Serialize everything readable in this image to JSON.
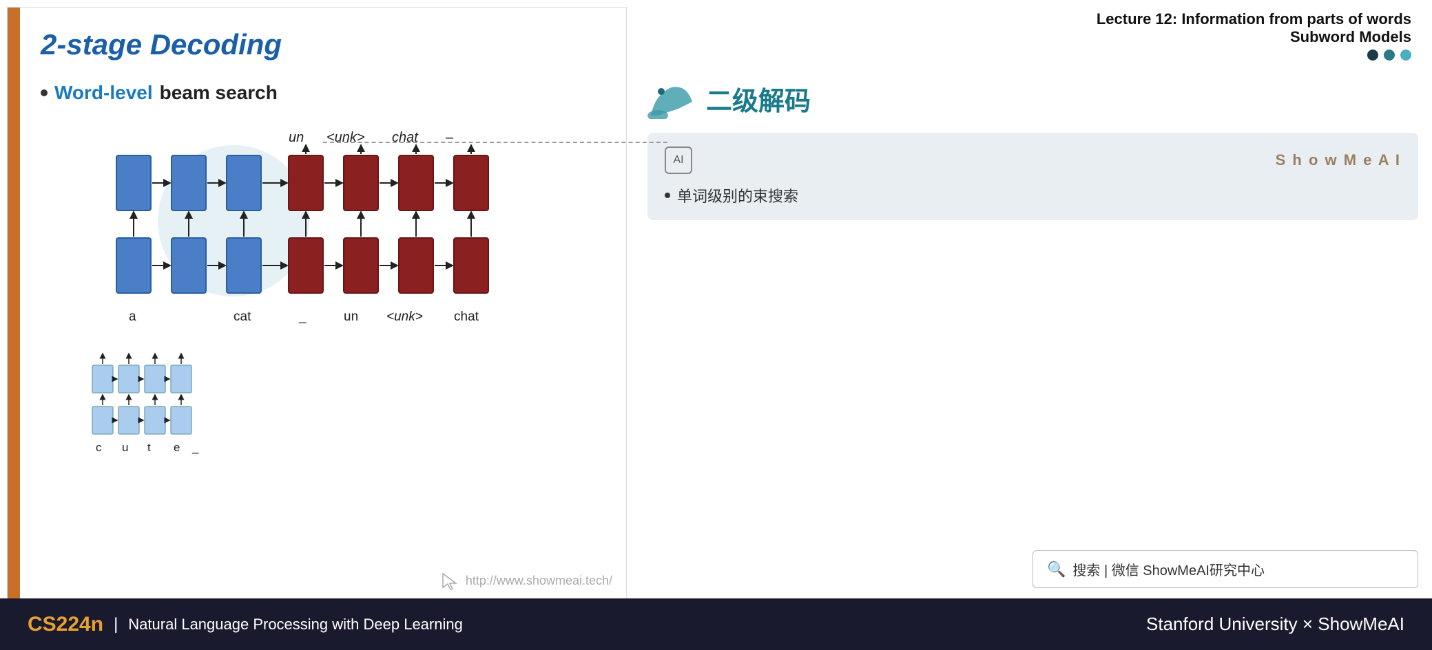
{
  "slide": {
    "title": "2-stage Decoding",
    "bullet1_colored": "Word-level",
    "bullet1_plain": " beam search",
    "watermark": "http://www.showmeai.tech/",
    "top_labels": {
      "un": "un",
      "unk": "<unk>",
      "chat": "chat",
      "dash": "–"
    },
    "bottom_labels": {
      "a": "a",
      "cat": "cat",
      "dash1": "_",
      "un": "un",
      "unk": "<unk>",
      "chat": "chat"
    },
    "char_labels": {
      "c": "c",
      "u": "u",
      "t": "t",
      "e": "e",
      "dash": "_"
    }
  },
  "right_panel": {
    "lecture_line1": "Lecture 12: Information from parts of words",
    "lecture_line2": "Subword Models",
    "chinese_title": "二级解码",
    "ai_brand": "S h o w M e A I",
    "ai_bullet": "单词级别的束搜索",
    "search_text": "搜索 | 微信 ShowMeAI研究中心"
  },
  "bottom_bar": {
    "course_code": "CS224n",
    "divider": "|",
    "course_desc": "Natural Language Processing with Deep Learning",
    "right_text": "Stanford University × ShowMeAI"
  }
}
